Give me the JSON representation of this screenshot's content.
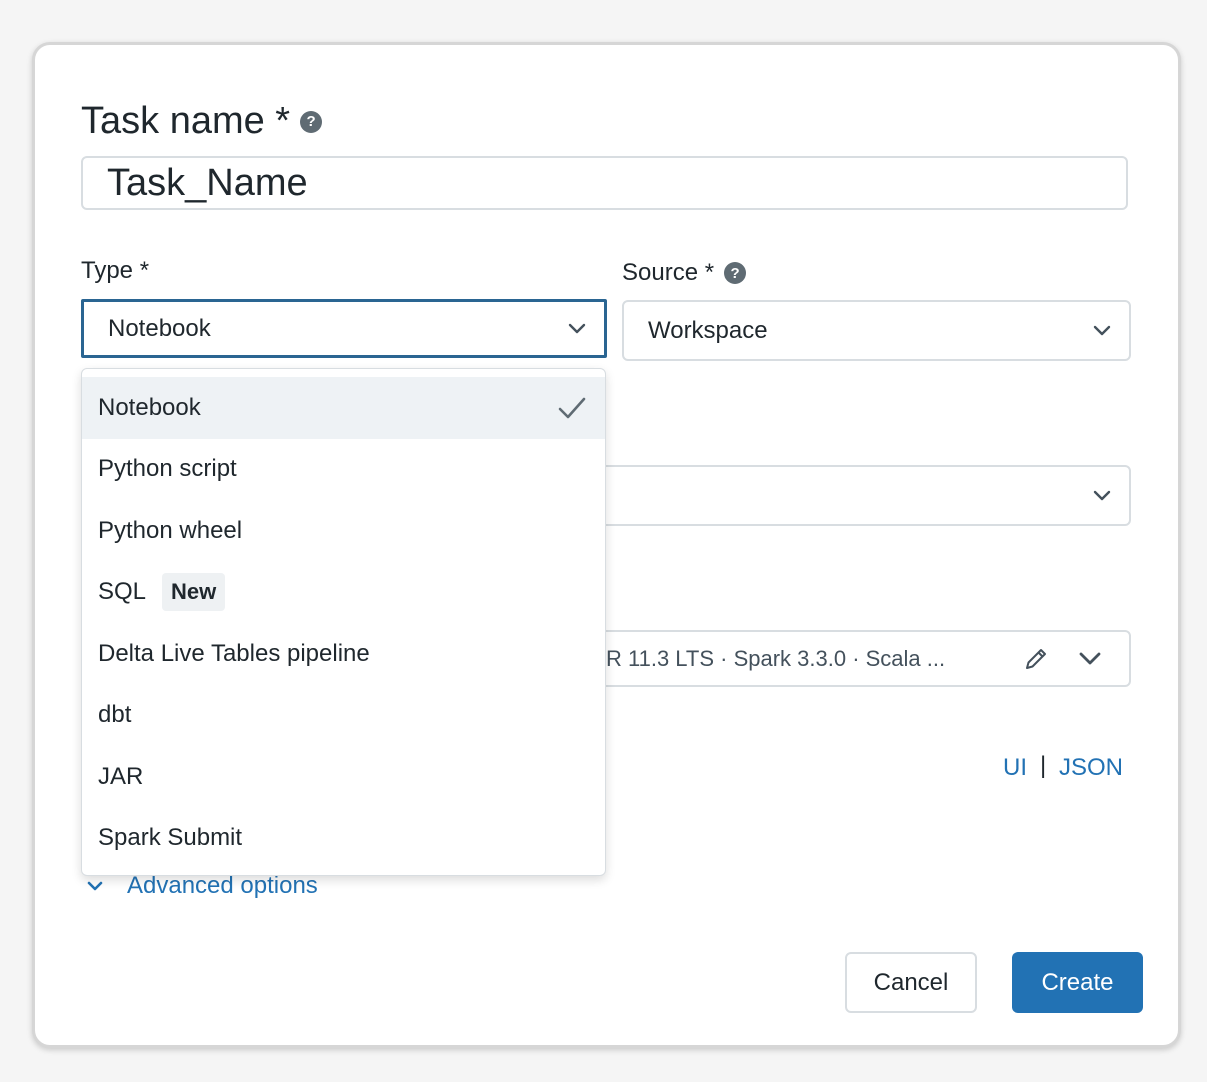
{
  "task_name": {
    "label": "Task name *",
    "value": "Task_Name"
  },
  "type": {
    "label": "Type *",
    "selected": "Notebook",
    "options": [
      {
        "label": "Notebook",
        "selected": true
      },
      {
        "label": "Python script"
      },
      {
        "label": "Python wheel"
      },
      {
        "label": "SQL",
        "badge": "New"
      },
      {
        "label": "Delta Live Tables pipeline"
      },
      {
        "label": "dbt"
      },
      {
        "label": "JAR"
      },
      {
        "label": "Spark Submit"
      }
    ]
  },
  "source": {
    "label": "Source *",
    "selected": "Workspace"
  },
  "cluster": {
    "summary": "R 11.3 LTS · Spark 3.3.0 · Scala ..."
  },
  "view_toggle": {
    "ui": "UI",
    "separator": "|",
    "json": "JSON"
  },
  "advanced_options": "Advanced options",
  "buttons": {
    "cancel": "Cancel",
    "create": "Create"
  },
  "colors": {
    "accent": "#2272b4",
    "focus_border": "#2a6592",
    "selected_row": "#eef2f5"
  }
}
